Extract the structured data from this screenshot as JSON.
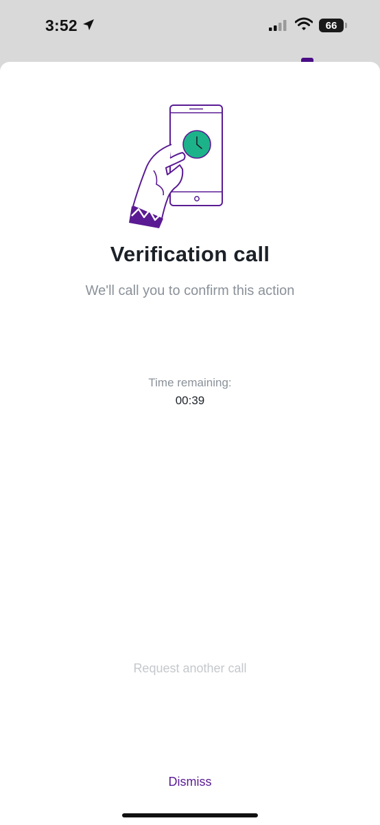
{
  "status_bar": {
    "time": "3:52",
    "battery_level": "66",
    "icons": [
      "location-arrow-icon",
      "cellular-signal-icon",
      "wifi-icon",
      "battery-icon"
    ]
  },
  "sheet": {
    "illustration": "phone-in-hand-clock-illustration",
    "title": "Verification call",
    "subtitle": "We'll call you to confirm this action",
    "timer_label": "Time remaining:",
    "timer_value": "00:39",
    "request_call_label": "Request another call",
    "dismiss_label": "Dismiss"
  },
  "colors": {
    "accent_purple": "#5a1a93",
    "illustration_green": "#1db38a",
    "title_text": "#1c2128",
    "muted_text": "#8a9199",
    "disabled_text": "#c4c8cc"
  }
}
